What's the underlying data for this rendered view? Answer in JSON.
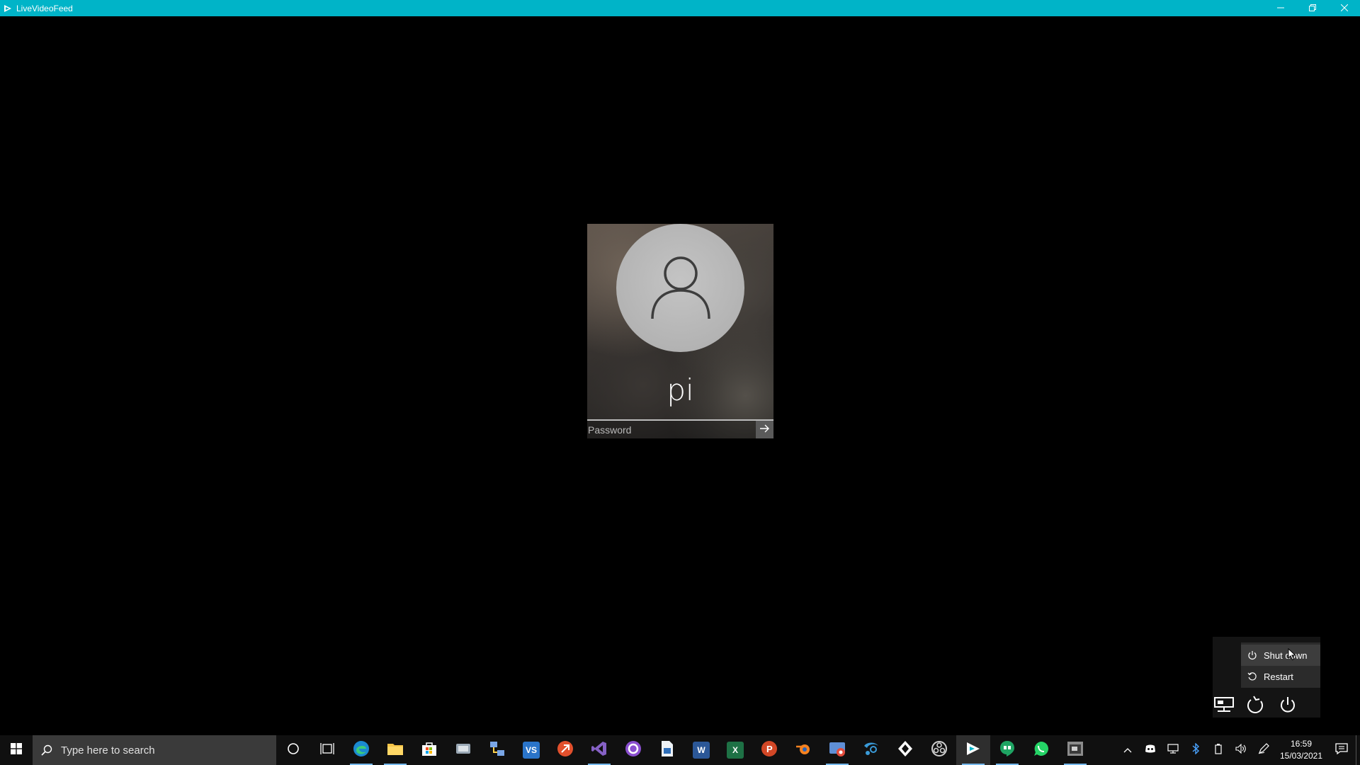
{
  "window": {
    "title": "LiveVideoFeed",
    "icon": "app-icon",
    "controls": [
      "minimize-icon",
      "restore-icon",
      "close-icon"
    ]
  },
  "login": {
    "username": "pi",
    "password_placeholder": "Password",
    "submit_icon": "arrow-right-icon",
    "avatar_icon": "user-icon"
  },
  "power_menu": {
    "items": [
      {
        "label": "Shut down",
        "icon": "power-icon"
      },
      {
        "label": "Restart",
        "icon": "restart-icon"
      }
    ],
    "bottom_icons": [
      "network-icon",
      "ease-of-access-icon",
      "power-icon"
    ]
  },
  "taskbar": {
    "search_placeholder": "Type here to search",
    "apps": [
      "cortana-icon",
      "task-view-icon",
      "edge-icon",
      "file-explorer-icon",
      "store-icon",
      "app-icon",
      "network-app-icon",
      "vscode-icon",
      "git-app-icon",
      "visual-studio-icon",
      "github-desktop-icon",
      "pdf-app-icon",
      "word-icon",
      "excel-icon",
      "powerpoint-icon",
      "blender-icon",
      "chrome-remote-icon",
      "steam-icon",
      "unity-icon",
      "obs-icon",
      "livevideofeed-icon",
      "hangouts-icon",
      "whatsapp-icon",
      "app-window-icon"
    ],
    "tray": [
      "chevron-up-icon",
      "discord-icon",
      "network-icon",
      "bluetooth-icon",
      "battery-icon",
      "volume-icon",
      "pen-icon"
    ],
    "time": "16:59",
    "date": "15/03/2021"
  },
  "colors": {
    "titlebar": "#00b4c8",
    "taskbar": "#101010",
    "accent_underline": "#76b9ed"
  }
}
